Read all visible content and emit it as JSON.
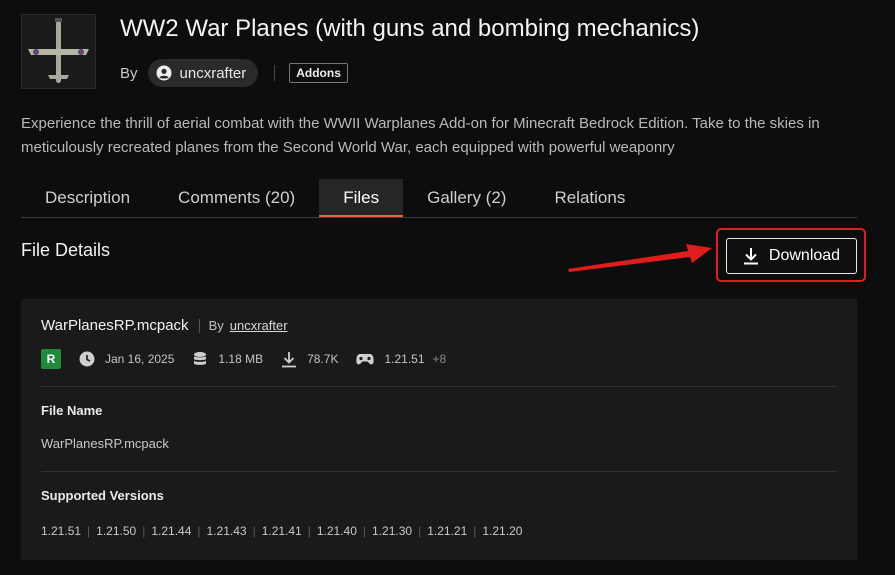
{
  "project": {
    "title": "WW2 War Planes (with guns and bombing mechanics)",
    "by_label": "By",
    "author": "uncxrafter",
    "category": "Addons",
    "description": "Experience the thrill of aerial combat with the WWII Warplanes Add-on for Minecraft Bedrock Edition. Take to the skies in meticulously recreated planes from the Second World War, each equipped with powerful weaponry"
  },
  "tabs": [
    {
      "label": "Description"
    },
    {
      "label": "Comments (20)"
    },
    {
      "label": "Files"
    },
    {
      "label": "Gallery (2)"
    },
    {
      "label": "Relations"
    }
  ],
  "active_tab": "Files",
  "section": {
    "title": "File Details",
    "download_label": "Download"
  },
  "file": {
    "name": "WarPlanesRP.mcpack",
    "by_label": "By",
    "author": "uncxrafter",
    "release_badge": "R",
    "date": "Jan 16, 2025",
    "size": "1.18 MB",
    "downloads": "78.7K",
    "game_version": "1.21.51",
    "more_versions": "+8",
    "file_name_label": "File Name",
    "file_name_value": "WarPlanesRP.mcpack",
    "supported_label": "Supported Versions",
    "supported_versions": [
      "1.21.51",
      "1.21.50",
      "1.21.44",
      "1.21.43",
      "1.21.41",
      "1.21.40",
      "1.21.30",
      "1.21.21",
      "1.21.20"
    ]
  },
  "colors": {
    "accent": "#e8643a",
    "annotation": "#e01c1c",
    "release_green": "#1f8a3c"
  },
  "icons": {
    "avatar": "user-circle-icon",
    "date": "clock-icon",
    "size": "database-icon",
    "downloads": "download-icon",
    "version": "gamepad-icon"
  }
}
